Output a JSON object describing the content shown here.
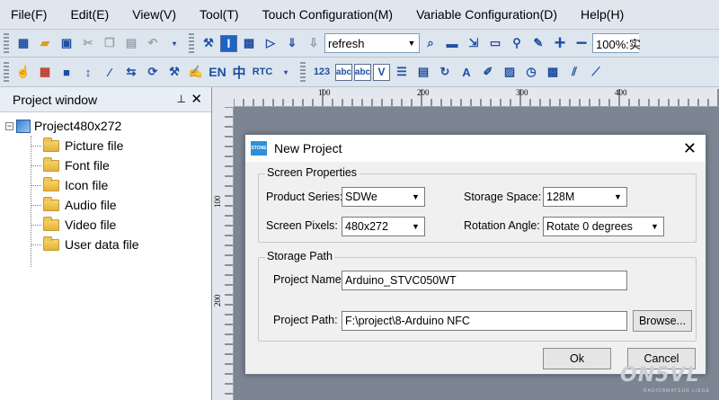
{
  "menu": [
    "File(F)",
    "Edit(E)",
    "View(V)",
    "Tool(T)",
    "Touch Configuration(M)",
    "Variable Configuration(D)",
    "Help(H)"
  ],
  "toolbar1": {
    "screen_combo": "refresh",
    "zoom_combo": "100%:实",
    "zoom_in": "+",
    "zoom_out": "−"
  },
  "toolbar2": {
    "en_label": "EN",
    "zh_label": "中",
    "rtc_label": "RTC",
    "num_label": "123",
    "abc_label": "abc",
    "v_label": "V"
  },
  "project_window": {
    "title": "Project window",
    "root": "Project480x272",
    "items": [
      "Picture file",
      "Font file",
      "Icon file",
      "Audio file",
      "Video file",
      "User data file"
    ]
  },
  "ruler": {
    "top_labels": [
      "100",
      "200",
      "300",
      "400"
    ],
    "left_labels": [
      "100",
      "200"
    ]
  },
  "dialog": {
    "title": "New Project",
    "icon_text": "STONE",
    "screen_properties": {
      "legend": "Screen Properties",
      "product_series_label": "Product Series:",
      "product_series_value": "SDWe",
      "storage_space_label": "Storage Space:",
      "storage_space_value": "128M",
      "screen_pixels_label": "Screen Pixels:",
      "screen_pixels_value": "480x272",
      "rotation_label": "Rotation Angle:",
      "rotation_value": "Rotate 0 degrees"
    },
    "storage_path": {
      "legend": "Storage Path",
      "project_name_label": "Project Name:",
      "project_name_value": "Arduino_STVC050WT",
      "project_path_label": "Project Path:",
      "project_path_value": "F:\\project\\8-Arduino NFC",
      "browse_label": "Browse..."
    },
    "ok_label": "Ok",
    "cancel_label": "Cancel"
  },
  "watermark": {
    "text": "ON5VL",
    "sub": "RADIOAMATEUR LIÈGE"
  }
}
